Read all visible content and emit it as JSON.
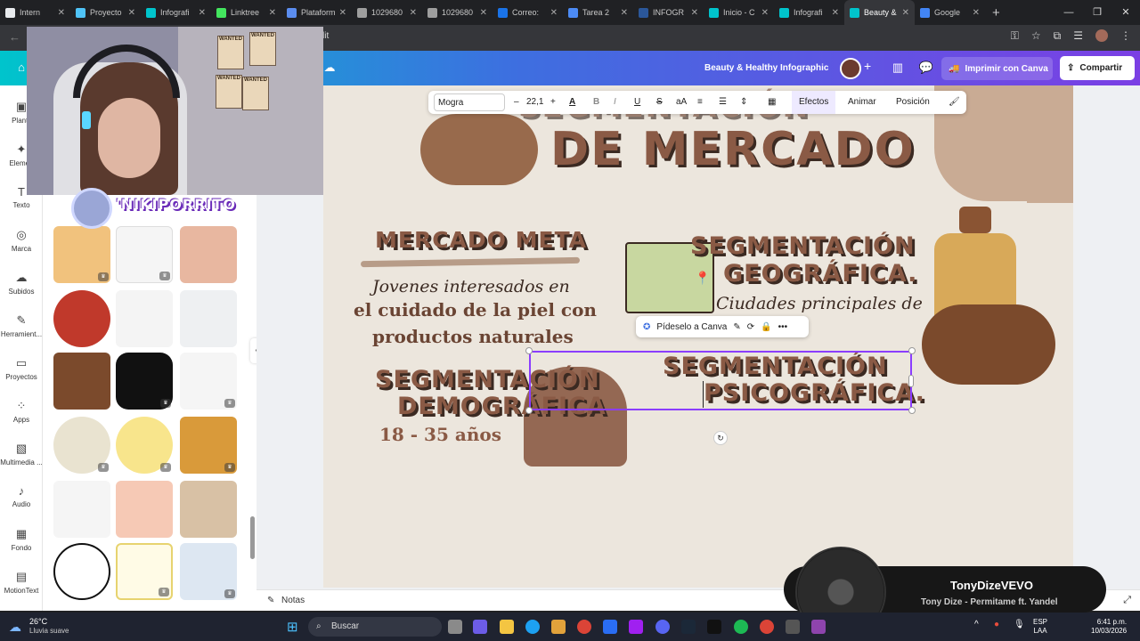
{
  "browser": {
    "tabs": [
      {
        "label": "Intern",
        "color": "#e8eaed"
      },
      {
        "label": "Proyecto",
        "color": "#4fc3f7"
      },
      {
        "label": "Infografi",
        "color": "#00c4cc"
      },
      {
        "label": "Linktree",
        "color": "#43e55e"
      },
      {
        "label": "Plataform",
        "color": "#5b8def"
      },
      {
        "label": "1029680",
        "color": "#9e9e9e"
      },
      {
        "label": "1029680",
        "color": "#9e9e9e"
      },
      {
        "label": "Correo:",
        "color": "#1a73e8"
      },
      {
        "label": "Tarea 2",
        "color": "#4c8bf5"
      },
      {
        "label": "INFOGR",
        "color": "#2b579a"
      },
      {
        "label": "Inicio - C",
        "color": "#00c4cc"
      },
      {
        "label": "Infografi",
        "color": "#00c4cc"
      },
      {
        "label": "Beauty &",
        "color": "#00c4cc"
      },
      {
        "label": "Google",
        "color": "#4285f4"
      }
    ],
    "new_tab": "+",
    "url_fragment": "lit"
  },
  "canva": {
    "doc_title": "Beauty & Healthy Infographic",
    "print_label": "Imprimir con Canva",
    "share_label": "Compartir",
    "rail": [
      {
        "label": "Plantil",
        "icon": "template-icon"
      },
      {
        "label": "Elemen",
        "icon": "elements-icon"
      },
      {
        "label": "Texto",
        "icon": "text-icon"
      },
      {
        "label": "Marca",
        "icon": "brand-icon"
      },
      {
        "label": "Subidos",
        "icon": "upload-icon"
      },
      {
        "label": "Herramient...",
        "icon": "tools-icon"
      },
      {
        "label": "Proyectos",
        "icon": "folder-icon"
      },
      {
        "label": "Apps",
        "icon": "apps-icon"
      },
      {
        "label": "Multimedia ...",
        "icon": "media-icon"
      },
      {
        "label": "Audio",
        "icon": "audio-icon"
      },
      {
        "label": "Fondo",
        "icon": "background-icon"
      },
      {
        "label": "MotionText",
        "icon": "motiontext-icon"
      }
    ],
    "toolbar": {
      "font": "Mogra",
      "size": "22,1",
      "minus": "–",
      "plus": "+",
      "effects": "Efectos",
      "animate": "Animar",
      "position": "Posición"
    },
    "ask_canva": "Pídeselo a Canva",
    "notes_label": "Notas"
  },
  "slide": {
    "title_line1": "SEGMENTACIÓN",
    "title_line2": "DE MERCADO",
    "meta_heading": "MERCADO META",
    "meta_body1": "Jovenes interesados en",
    "meta_body2": "el cuidado de la piel con",
    "meta_body3": "productos naturales",
    "geo_heading1": "SEGMENTACIÓN",
    "geo_heading2": "GEOGRÁFICA.",
    "geo_body": "Ciudades principales de",
    "demo_heading1": "SEGMENTACIÓN",
    "demo_heading2": "DEMOGRÁFICA",
    "demo_body": "18 - 35 años",
    "psico_heading1": "SEGMENTACIÓN",
    "psico_heading2": "PSICOGRÁFICA."
  },
  "stream": {
    "nickname": "'NIKIPORRITO",
    "posters": [
      "WANTED",
      "WANTED",
      "WANTED",
      "WANTED"
    ]
  },
  "music": {
    "channel": "TonyDizeVEVO",
    "track": "Tony Dize - Permitame ft. Yandel"
  },
  "taskbar": {
    "temp": "26°C",
    "weather": "Lluvia suave",
    "search_placeholder": "Buscar",
    "lang1": "ESP",
    "lang2": "LAA",
    "time": "6:41 p.m.",
    "date": "10/03/2026"
  }
}
